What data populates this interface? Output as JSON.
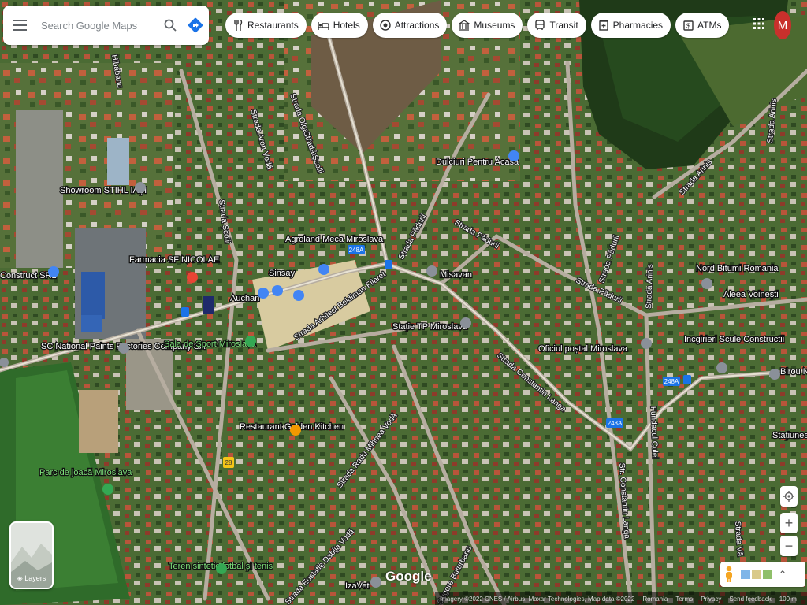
{
  "search": {
    "placeholder": "Search Google Maps"
  },
  "chips": [
    {
      "label": "Restaurants",
      "icon": "fork-knife-icon"
    },
    {
      "label": "Hotels",
      "icon": "bed-icon"
    },
    {
      "label": "Attractions",
      "icon": "camera-icon"
    },
    {
      "label": "Museums",
      "icon": "museum-icon"
    },
    {
      "label": "Transit",
      "icon": "bus-icon"
    },
    {
      "label": "Pharmacies",
      "icon": "pharmacy-icon"
    },
    {
      "label": "ATMs",
      "icon": "atm-icon"
    }
  ],
  "account": {
    "initial": "M",
    "color": "#c9302c"
  },
  "layers": {
    "label": "Layers"
  },
  "map": {
    "places": [
      "Showroom STIHL IAȘI",
      "Construct SRL",
      "Farmacia SF NICOLAE",
      "Agroland Meca Miroslava",
      "Sinsay",
      "Auchan",
      "SC National Paints Factories Company SA",
      "Sala de Sport Miroslava",
      "Restaurant Golden Kitchen",
      "Parc de joacă Miroslava",
      "Teren sintetic fotbal și tenis",
      "Dulciuri Pentru Acasă",
      "Misavan",
      "Stație TP Miroslava",
      "Oficiul poștal Miroslava",
      "Nord Bitumi Romania",
      "Aleea Voinești",
      "Incgirieri Scule Constructii",
      "Birou N Iulia Pa",
      "Stațiunea de ști Produc",
      "IzaVet"
    ],
    "streets": [
      "Strada Olga Sturdza",
      "Strada Aron Vodă",
      "Strada Școlii",
      "Strada Școlii",
      "Strada Pădurii",
      "Strada Pădurii",
      "Strada Pădurii",
      "Strada Pădurii",
      "Strada Arhitect Beldiman Filaret",
      "Strada Constantin Langa",
      "Strada Radu Mihnea Vodă",
      "Strada Eustatie Dabija Vodă",
      "Strada Arinis",
      "Strada Arinis",
      "Strada Arinis",
      "Fundacul Culei",
      "Str. Constantin Langa",
      "Strada Vă",
      "Hibabanu",
      "Grigore Buturbanu"
    ],
    "route_badges": [
      "248A",
      "248A",
      "248A",
      "28"
    ]
  },
  "logo": "Google",
  "footer": {
    "attribution": "Imagery ©2022 CNES / Airbus, Maxar Technologies, Map data ©2022",
    "region": "Romania",
    "terms": "Terms",
    "privacy": "Privacy",
    "feedback": "Send feedback",
    "scale": "100 m"
  },
  "colors": {
    "accent_blue": "#1a73e8",
    "pin_blue": "#4285f4",
    "pin_red": "#ea4335",
    "pin_green": "#34a853",
    "pin_orange": "#f29900"
  }
}
